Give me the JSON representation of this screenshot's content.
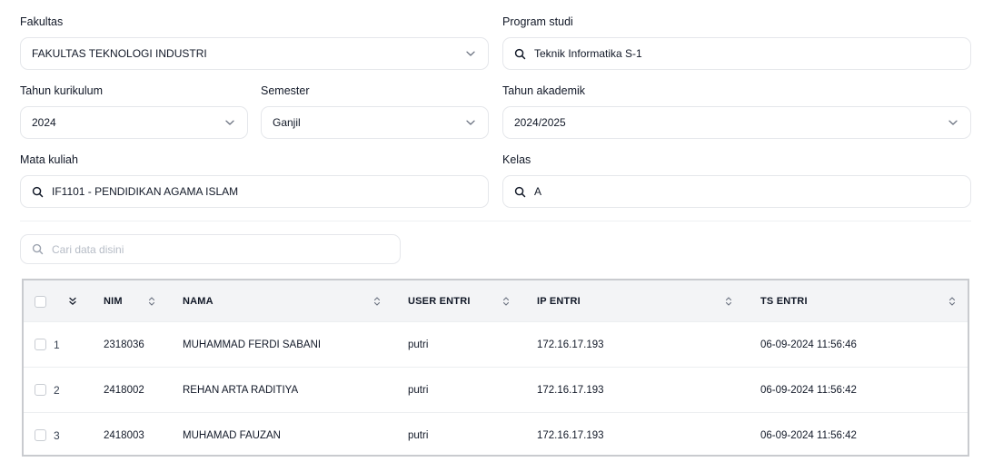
{
  "filters": {
    "fakultas": {
      "label": "Fakultas",
      "value": "FAKULTAS TEKNOLOGI INDUSTRI"
    },
    "program_studi": {
      "label": "Program studi",
      "value": "Teknik Informatika S-1"
    },
    "tahun_kurikulum": {
      "label": "Tahun kurikulum",
      "value": "2024"
    },
    "semester": {
      "label": "Semester",
      "value": "Ganjil"
    },
    "tahun_akademik": {
      "label": "Tahun akademik",
      "value": "2024/2025"
    },
    "mata_kuliah": {
      "label": "Mata kuliah",
      "value": "IF1101 - PENDIDIKAN AGAMA ISLAM"
    },
    "kelas": {
      "label": "Kelas",
      "value": "A"
    }
  },
  "search": {
    "placeholder": "Cari data disini"
  },
  "table": {
    "columns": {
      "nim": "NIM",
      "nama": "NAMA",
      "user_entri": "USER ENTRI",
      "ip_entri": "IP ENTRI",
      "ts_entri": "TS ENTRI"
    },
    "rows": [
      {
        "no": "1",
        "nim": "2318036",
        "nama": "MUHAMMAD FERDI SABANI",
        "user_entri": "putri",
        "ip_entri": "172.16.17.193",
        "ts_entri": "06-09-2024 11:56:46"
      },
      {
        "no": "2",
        "nim": "2418002",
        "nama": "REHAN ARTA RADITIYA",
        "user_entri": "putri",
        "ip_entri": "172.16.17.193",
        "ts_entri": "06-09-2024 11:56:42"
      },
      {
        "no": "3",
        "nim": "2418003",
        "nama": "MUHAMAD FAUZAN",
        "user_entri": "putri",
        "ip_entri": "172.16.17.193",
        "ts_entri": "06-09-2024 11:56:42"
      }
    ]
  },
  "icons": {
    "dropdown": "chevron-down-icon",
    "search": "search-icon",
    "sort": "sort-icon",
    "expand_all": "chevrons-down-icon"
  },
  "colors": {
    "border": "#e5e7eb",
    "header_bg": "#f3f4f6",
    "frame": "#c9cbcf",
    "placeholder": "#b6bcc6"
  }
}
